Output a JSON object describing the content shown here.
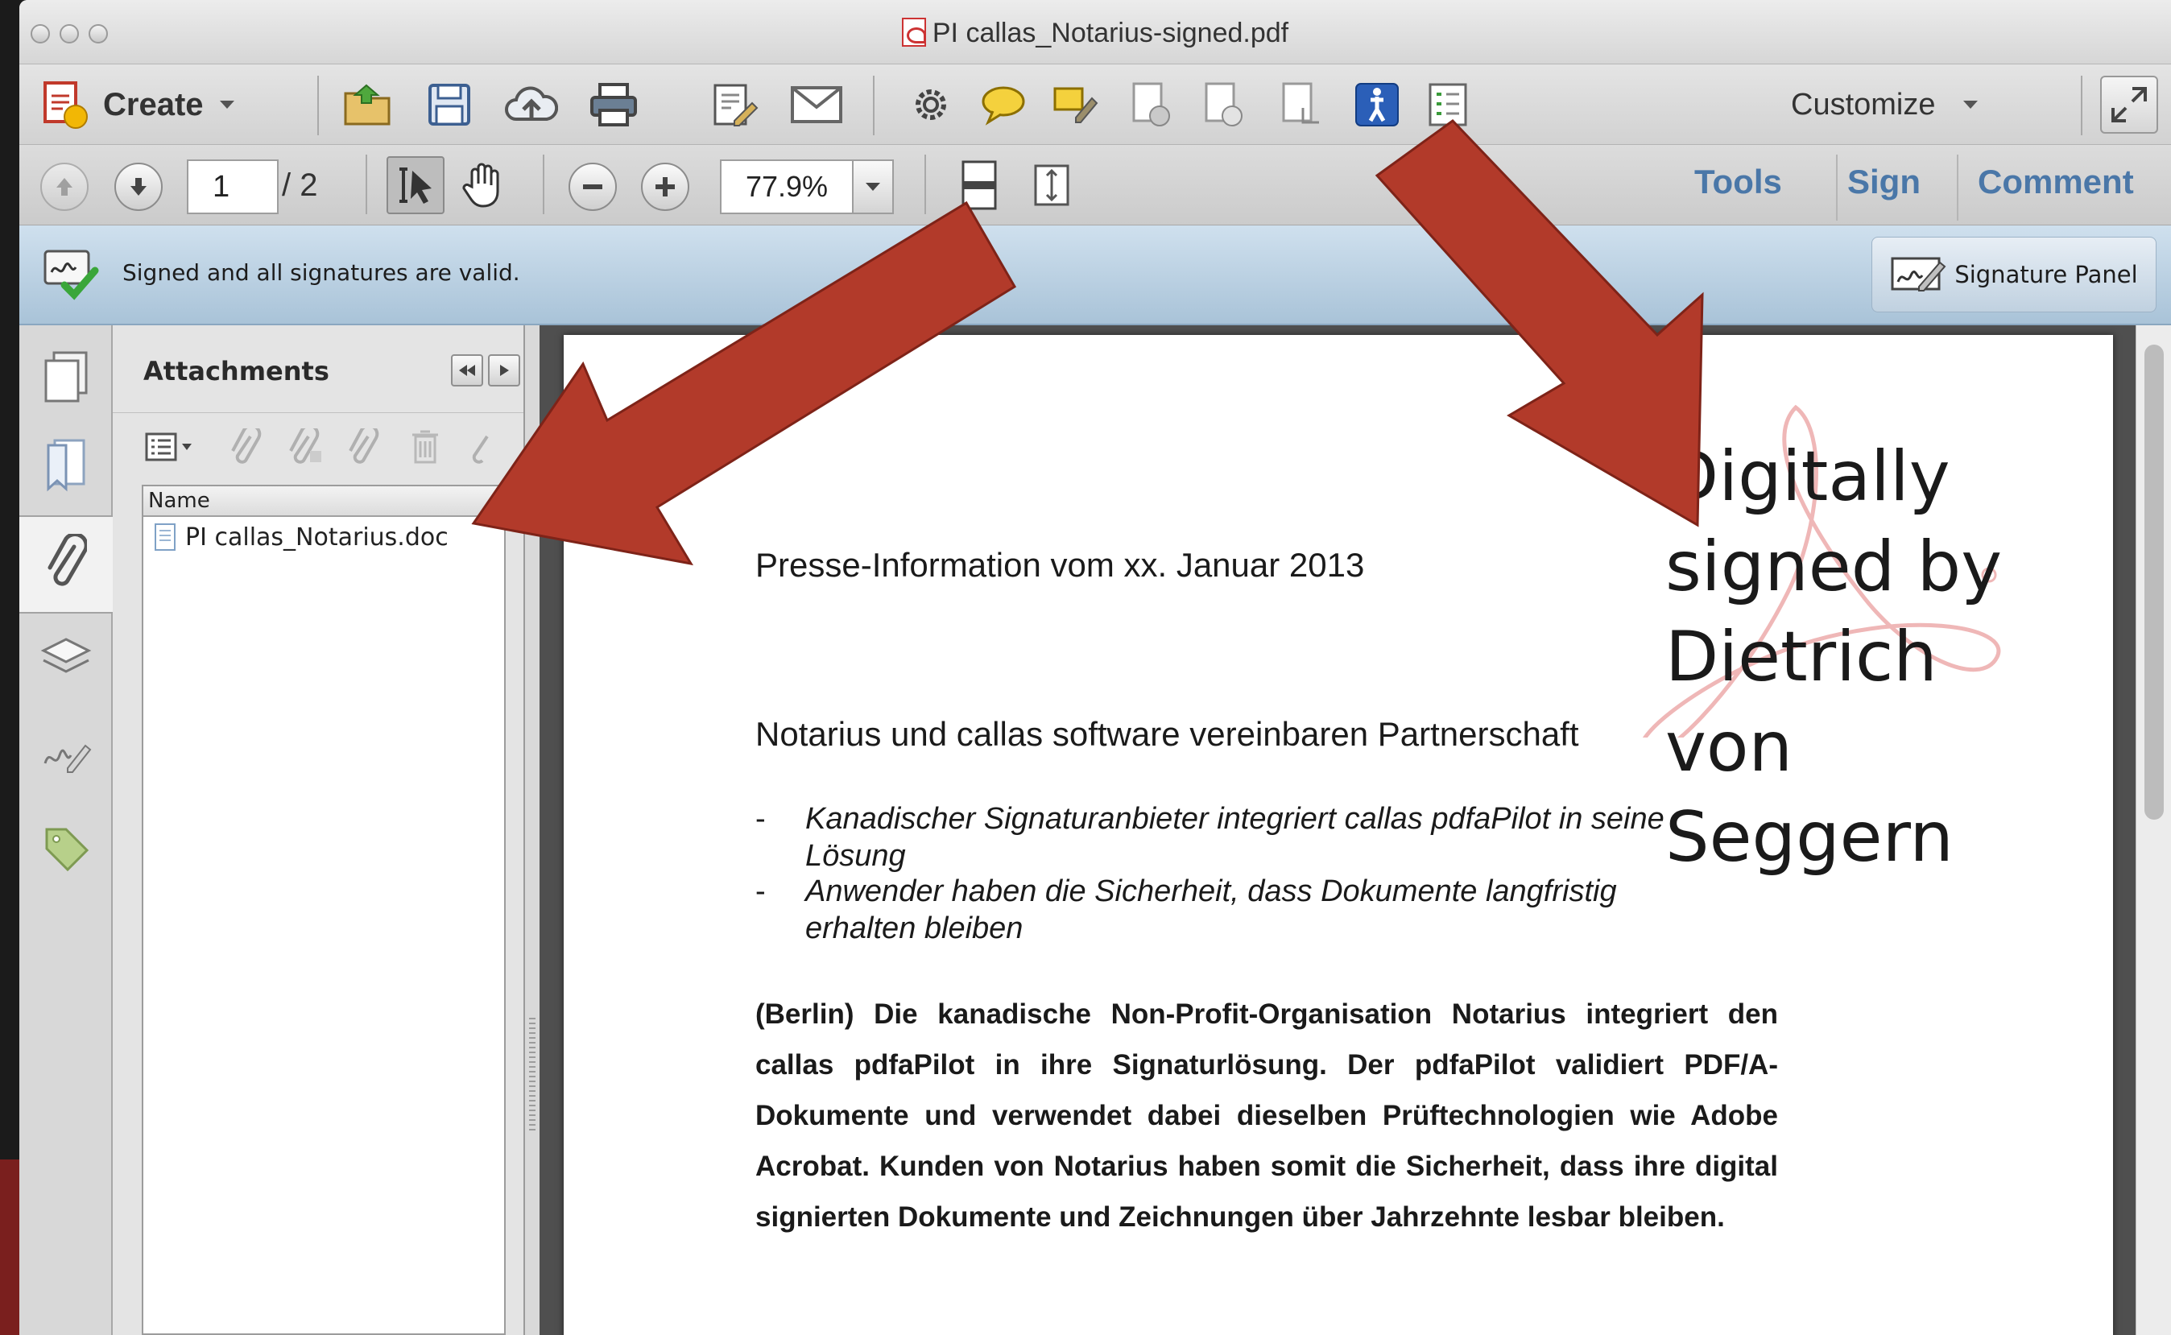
{
  "window": {
    "title": "PI callas_Notarius-signed.pdf"
  },
  "toolbar": {
    "create_label": "Create",
    "customize_label": "Customize",
    "icons": [
      "open-folder-icon",
      "save-icon",
      "cloud-upload-icon",
      "print-icon",
      "edit-doc-icon",
      "email-icon",
      "gear-icon",
      "comment-bubble-icon",
      "highlight-icon",
      "doc-action-icon",
      "doc-compare-icon",
      "doc-export-icon",
      "accessibility-icon",
      "checklist-icon"
    ]
  },
  "navigation": {
    "current_page": "1",
    "page_total": "/ 2",
    "zoom": "77.9%",
    "tabs": [
      "Tools",
      "Sign",
      "Comment"
    ]
  },
  "signature_bar": {
    "message": "Signed and all signatures are valid.",
    "panel_button": "Signature Panel"
  },
  "attachments": {
    "title": "Attachments",
    "column_header": "Name",
    "files": [
      {
        "name": "PI callas_Notarius.doc"
      }
    ]
  },
  "document": {
    "date_line": "Presse-Information vom xx. Januar 2013",
    "headline": "Notarius und callas software vereinbaren Partnerschaft",
    "bullets": [
      {
        "marker": "-",
        "text": "Kanadischer Signaturanbieter integriert callas pdfaPilot in seine Lösung"
      },
      {
        "marker": "-",
        "text": "Anwender haben die Sicherheit, dass Dokumente langfristig erhalten bleiben"
      }
    ],
    "body": "(Berlin) Die kanadische Non-Profit-Organisation Notarius integriert den callas pdfaPilot in ihre Signaturlösung. Der pdfaPilot validiert PDF/A-Dokumente und verwendet dabei dieselben Prüftechnologien wie Adobe Acrobat. Kunden von Notarius haben somit die Sicherheit, dass ihre digital signierten Dokumente und Zeichnungen über Jahrzehnte lesbar bleiben.",
    "signature_lines": [
      "Digitally",
      "signed by",
      "Dietrich von",
      "Seggern"
    ]
  },
  "colors": {
    "accent_tab": "#4a77a8",
    "annotation_arrow": "#b23a2a",
    "signature_bar": "#b9cfe2"
  }
}
